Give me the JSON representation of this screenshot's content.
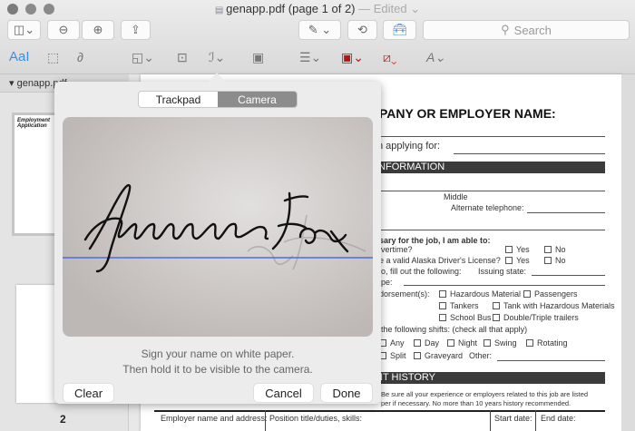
{
  "window": {
    "filename": "genapp.pdf (page 1 of 2)",
    "edited": "— Edited ⌄"
  },
  "toolbar": {
    "search_placeholder": "Search",
    "markup_text": "AaI"
  },
  "sidebar": {
    "header": "genapp.pdf",
    "thumb1_title": "Employment Application",
    "page2_label": "2"
  },
  "document": {
    "heading": "PANY OR EMPLOYER NAME:",
    "applying_for": "n applying for:",
    "section1": "INFORMATION",
    "middle": "Middle",
    "alt_phone": "Alternate telephone:",
    "able_to": "sary for the job, I am able to:",
    "overtime": "vertime?",
    "license": "e a valid Alaska Driver's License?",
    "fill_out": "o, fill out the following:",
    "issuing_state": "Issuing state:",
    "type": "pe:",
    "endorsement": "dorsement(s):",
    "yes": "Yes",
    "no": "No",
    "endorsements": [
      "Hazardous Material",
      "Passengers",
      "Tankers",
      "Tank with Hazardous Materials",
      "School Bus",
      "Double/Triple trailers"
    ],
    "shifts_label": "the following shifts: (check all that apply)",
    "shifts": [
      "Any",
      "Day",
      "Night",
      "Swing",
      "Rotating",
      "Split",
      "Graveyard"
    ],
    "other": "Other:",
    "section2": "NT HISTORY",
    "note1": "Be sure all your experience or employers related to this job are listed",
    "note2": "per if necessary. No more than 10 years history recommended.",
    "table_headers": [
      "Employer name and address:",
      "Position title/duties, skills:",
      "Start date:",
      "End date:"
    ]
  },
  "signature_popover": {
    "tabs": [
      "Trackpad",
      "Camera"
    ],
    "active_tab": "Camera",
    "hint_line1": "Sign your name on white paper.",
    "hint_line2": "Then hold it to be visible to the camera.",
    "clear": "Clear",
    "cancel": "Cancel",
    "done": "Done",
    "baseline_color": "#4a6fd8"
  }
}
